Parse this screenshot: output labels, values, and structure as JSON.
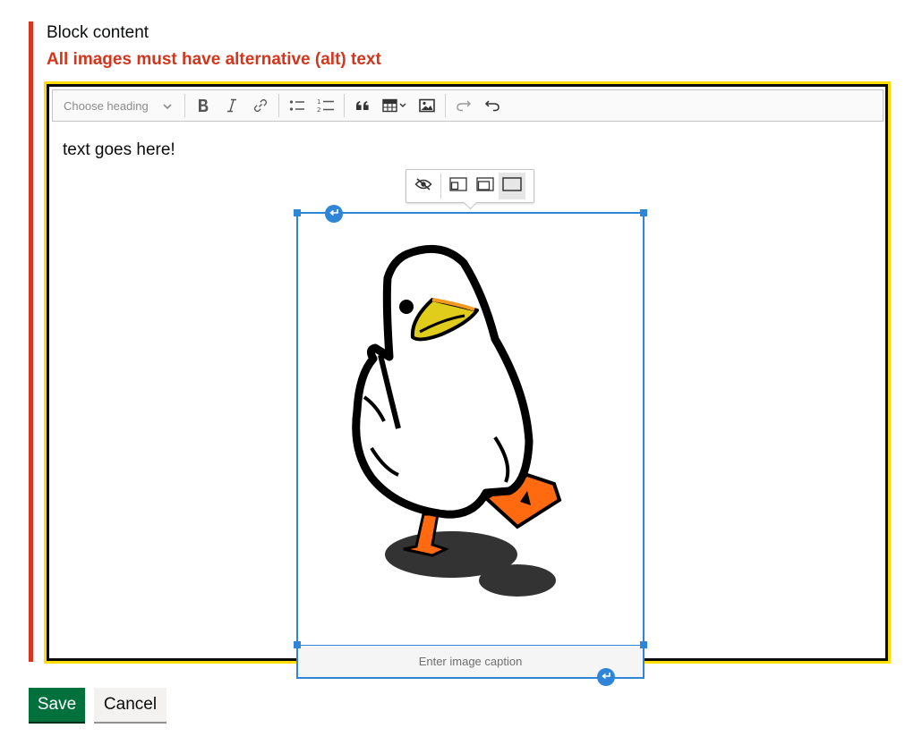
{
  "field": {
    "label": "Block content",
    "error": "All images must have alternative (alt) text"
  },
  "toolbar": {
    "heading_placeholder": "Choose heading",
    "buttons": [
      {
        "name": "bold",
        "icon": "bold-icon"
      },
      {
        "name": "italic",
        "icon": "italic-icon"
      },
      {
        "name": "link",
        "icon": "link-icon"
      },
      {
        "name": "bulleted-list",
        "icon": "bulleted-list-icon"
      },
      {
        "name": "numbered-list",
        "icon": "numbered-list-icon"
      },
      {
        "name": "block-quote",
        "icon": "quote-icon"
      },
      {
        "name": "insert-table",
        "icon": "table-icon"
      },
      {
        "name": "insert-image",
        "icon": "image-icon"
      },
      {
        "name": "redo",
        "icon": "redo-icon",
        "disabled": true
      },
      {
        "name": "undo",
        "icon": "undo-icon"
      }
    ]
  },
  "content": {
    "paragraph": "text goes here!",
    "image_caption_placeholder": "Enter image caption"
  },
  "image_toolbar": {
    "buttons": [
      "hide-icon",
      "align-left-icon",
      "align-right-icon",
      "full-width-icon"
    ],
    "active": "full-width-icon"
  },
  "actions": {
    "save": "Save",
    "cancel": "Cancel"
  },
  "colors": {
    "error": "#d4351c",
    "focus": "#ffdd00",
    "selection": "#2f86d8",
    "save_button": "#00703c"
  }
}
